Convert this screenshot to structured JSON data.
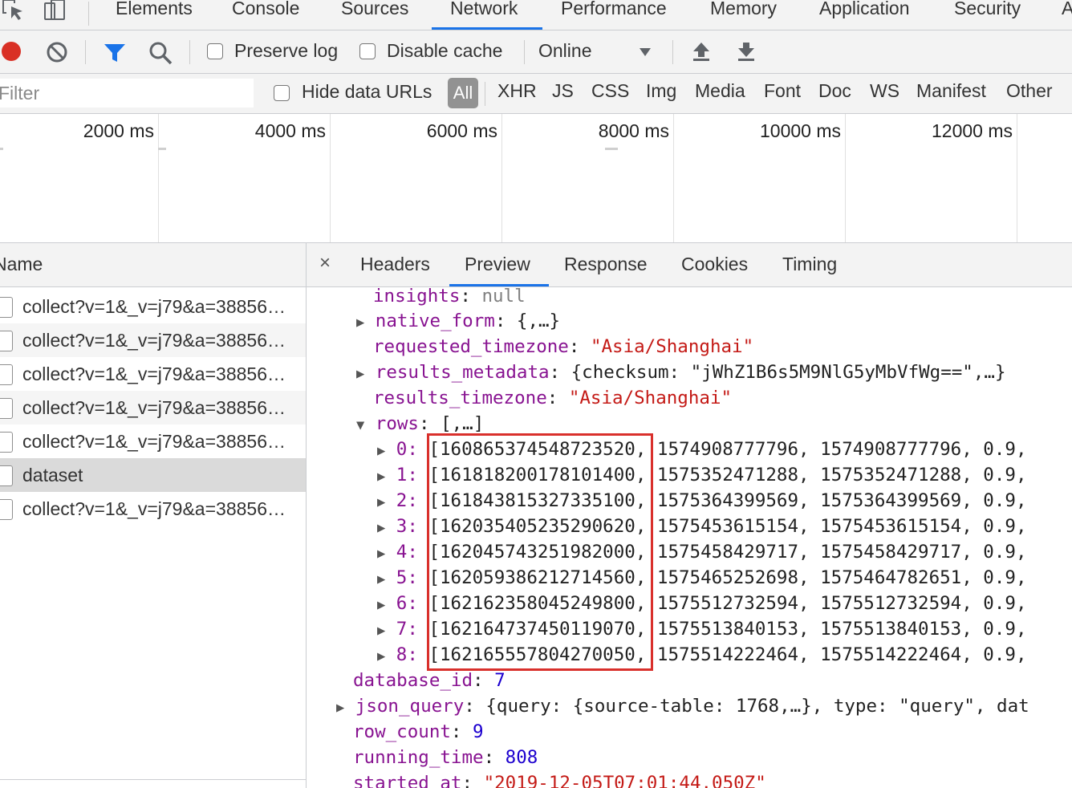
{
  "toptabs": [
    {
      "label": "Elements",
      "active": false
    },
    {
      "label": "Console",
      "active": false
    },
    {
      "label": "Sources",
      "active": false
    },
    {
      "label": "Network",
      "active": true
    },
    {
      "label": "Performance",
      "active": false
    },
    {
      "label": "Memory",
      "active": false
    },
    {
      "label": "Application",
      "active": false
    },
    {
      "label": "Security",
      "active": false
    },
    {
      "label": "A",
      "active": false
    }
  ],
  "toolbar": {
    "preserve_log": "Preserve log",
    "disable_cache": "Disable cache",
    "throttle": "Online",
    "record_color": "#d93025",
    "filter_icon_color": "#1a73e8"
  },
  "filterbar": {
    "placeholder": "Filter",
    "hide_data_urls": "Hide data URLs",
    "types": [
      "All",
      "XHR",
      "JS",
      "CSS",
      "Img",
      "Media",
      "Font",
      "Doc",
      "WS",
      "Manifest",
      "Other"
    ]
  },
  "timeline": {
    "labels": [
      "2000 ms",
      "4000 ms",
      "6000 ms",
      "8000 ms",
      "10000 ms",
      "12000 ms"
    ]
  },
  "requests": {
    "header": "Name",
    "rows": [
      "collect?v=1&_v=j79&a=38856…",
      "collect?v=1&_v=j79&a=38856…",
      "collect?v=1&_v=j79&a=38856…",
      "collect?v=1&_v=j79&a=38856…",
      "collect?v=1&_v=j79&a=38856…",
      "dataset",
      "collect?v=1&_v=j79&a=38856…"
    ],
    "selected_index": 5
  },
  "detail": {
    "tabs": [
      "Headers",
      "Preview",
      "Response",
      "Cookies",
      "Timing"
    ],
    "active_tab": "Preview",
    "close": "×"
  },
  "preview": {
    "insights": {
      "key": "insights",
      "value": "null"
    },
    "native_form": {
      "key": "native_form",
      "value": "{,…}"
    },
    "requested_timezone": {
      "key": "requested_timezone",
      "value": "\"Asia/Shanghai\""
    },
    "results_metadata": {
      "key": "results_metadata",
      "value": "{checksum: \"jWhZ1B6s5M9NlG5yMbVfWg==\",…}"
    },
    "results_timezone": {
      "key": "results_timezone",
      "value": "\"Asia/Shanghai\""
    },
    "rows_label": {
      "key": "rows",
      "value": "[,…]"
    },
    "rows": [
      {
        "index": "0",
        "id": "[160865374548723520",
        "rest": "1574908777796, 1574908777796, 0.9,"
      },
      {
        "index": "1",
        "id": "[161818200178101400",
        "rest": "1575352471288, 1575352471288, 0.9,"
      },
      {
        "index": "2",
        "id": "[161843815327335100",
        "rest": "1575364399569, 1575364399569, 0.9,"
      },
      {
        "index": "3",
        "id": "[162035405235290620",
        "rest": "1575453615154, 1575453615154, 0.9,"
      },
      {
        "index": "4",
        "id": "[162045743251982000",
        "rest": "1575458429717, 1575458429717, 0.9,"
      },
      {
        "index": "5",
        "id": "[162059386212714560",
        "rest": "1575465252698, 1575464782651, 0.9,"
      },
      {
        "index": "6",
        "id": "[162162358045249800",
        "rest": "1575512732594, 1575512732594, 0.9,"
      },
      {
        "index": "7",
        "id": "[162164737450119070",
        "rest": "1575513840153, 1575513840153, 0.9,"
      },
      {
        "index": "8",
        "id": "[162165557804270050",
        "rest": "1575514222464, 1575514222464, 0.9,"
      }
    ],
    "database_id": {
      "key": "database_id",
      "value": "7"
    },
    "json_query": {
      "key": "json_query",
      "value": "{query: {source-table: 1768,…}, type: \"query\", dat"
    },
    "row_count": {
      "key": "row_count",
      "value": "9"
    },
    "running_time": {
      "key": "running_time",
      "value": "808"
    },
    "started_at": {
      "key": "started_at",
      "value": "\"2019-12-05T07:01:44.050Z\""
    }
  }
}
